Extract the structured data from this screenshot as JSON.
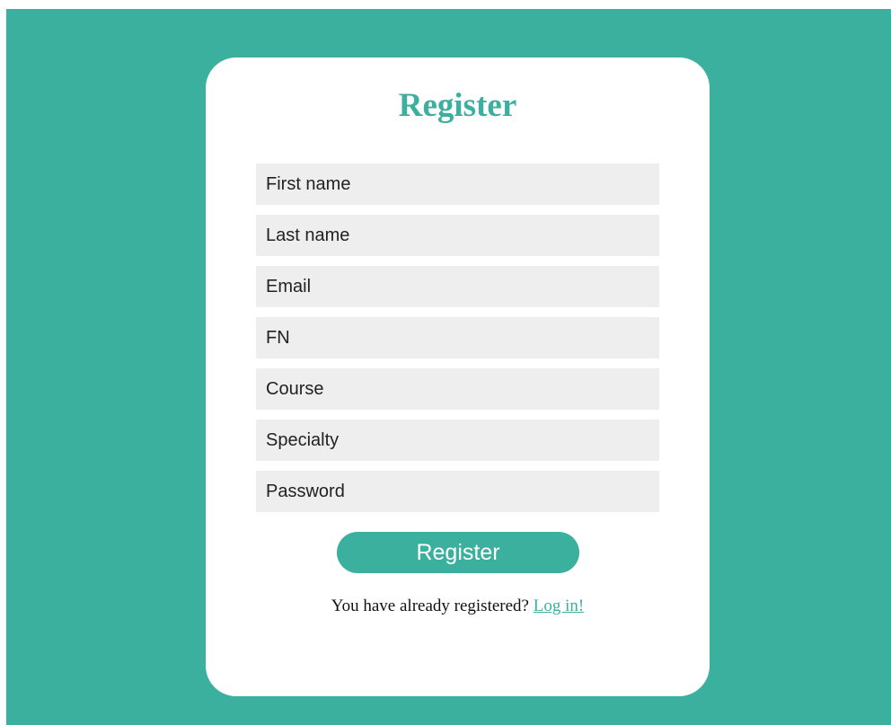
{
  "colors": {
    "accent": "#3bb09f",
    "card": "#ffffff",
    "field_bg": "#eeeeee"
  },
  "form": {
    "title": "Register",
    "fields": [
      {
        "name": "first-name",
        "placeholder": "First name",
        "value": ""
      },
      {
        "name": "last-name",
        "placeholder": "Last name",
        "value": ""
      },
      {
        "name": "email",
        "placeholder": "Email",
        "value": ""
      },
      {
        "name": "fn",
        "placeholder": "FN",
        "value": ""
      },
      {
        "name": "course",
        "placeholder": "Course",
        "value": ""
      },
      {
        "name": "specialty",
        "placeholder": "Specialty",
        "value": ""
      },
      {
        "name": "password",
        "placeholder": "Password",
        "value": ""
      }
    ],
    "submit_label": "Register",
    "footer_text": "You have already registered?",
    "login_link": "Log in!"
  }
}
